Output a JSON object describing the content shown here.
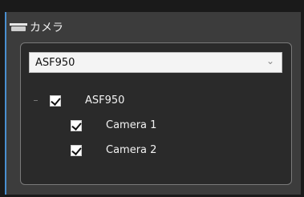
{
  "panel": {
    "title": "カメラ",
    "icon": "camera-icon"
  },
  "site_select": {
    "value": "ASF950",
    "icon": "chevron-down-icon"
  },
  "tree": {
    "root": {
      "label": "ASF950",
      "checked": true
    },
    "children": [
      {
        "label": "Camera 1",
        "checked": true
      },
      {
        "label": "Camera 2",
        "checked": true
      }
    ]
  },
  "colors": {
    "panel_bg": "#3c3c3c",
    "content_bg": "#2a2a2a",
    "accent": "#4a8fd0"
  }
}
